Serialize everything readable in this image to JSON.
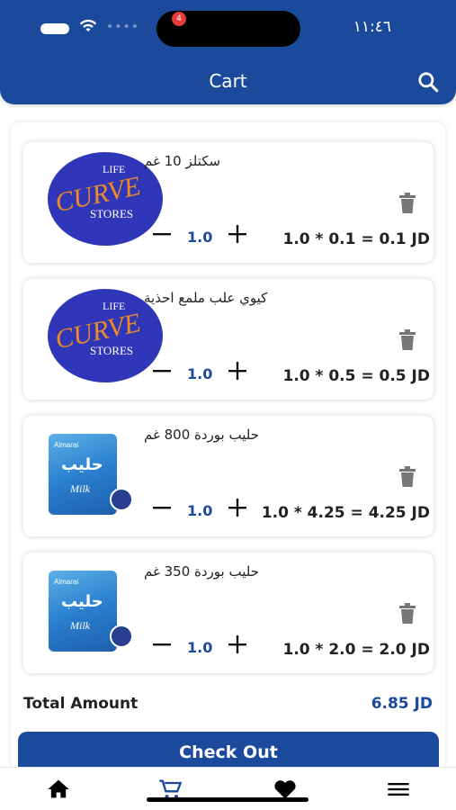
{
  "status_bar": {
    "time": "١١:٤٦"
  },
  "header": {
    "title": "Cart"
  },
  "items": [
    {
      "name": "سكتلز 10 غم",
      "quantity": "1.0",
      "price_line": "1.0 * 0.1 = 0.1 JD",
      "image": "curve-stores-logo"
    },
    {
      "name": "كيوي علب ملمع احذية",
      "quantity": "1.0",
      "price_line": "1.0 * 0.5 = 0.5 JD",
      "image": "curve-stores-logo"
    },
    {
      "name": "حليب بوردة 800 غم",
      "quantity": "1.0",
      "price_line": "1.0 * 4.25 = 4.25 JD",
      "image": "milk-powder-bag"
    },
    {
      "name": "حليب بوردة 350 غم",
      "quantity": "1.0",
      "price_line": "1.0 * 2.0 = 2.0 JD",
      "image": "milk-powder-bag"
    }
  ],
  "logo_text": {
    "life": "LIFE",
    "curve": "CURVE",
    "stores": "STORES"
  },
  "milk_text": {
    "brand": "Almarai",
    "arabic": "حليب",
    "milk": "Milk"
  },
  "total": {
    "label": "Total Amount",
    "value": "6.85 JD"
  },
  "checkout": {
    "label": "Check Out"
  },
  "nav": {
    "cart_badge": "4"
  },
  "colors": {
    "primary": "#1b4a9c",
    "badge": "#e63b3b"
  }
}
